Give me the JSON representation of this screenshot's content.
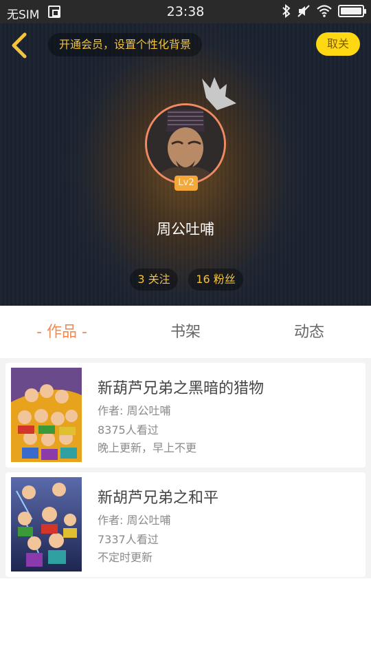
{
  "status_bar": {
    "carrier": "无SIM",
    "time": "23:38"
  },
  "header": {
    "vip_banner": "开通会员，设置个性化背景",
    "follow_label": "取关"
  },
  "profile": {
    "level": "Lv2",
    "name": "周公吐哺",
    "following": "3 关注",
    "fans": "16 粉丝"
  },
  "tabs": [
    {
      "label": "- 作品 -",
      "active": true
    },
    {
      "label": "书架",
      "active": false
    },
    {
      "label": "动态",
      "active": false
    }
  ],
  "works": [
    {
      "title": "新葫芦兄弟之黑暗的猎物",
      "author": "作者: 周公吐哺",
      "views": "8375人看过",
      "schedule": "晚上更新，早上不更"
    },
    {
      "title": "新胡芦兄弟之和平",
      "author": "作者: 周公吐哺",
      "views": "7337人看过",
      "schedule": "不定时更新"
    }
  ],
  "colors": {
    "accent": "#f08a52",
    "gold": "#f4c43a",
    "follow_button": "#ffd814"
  }
}
